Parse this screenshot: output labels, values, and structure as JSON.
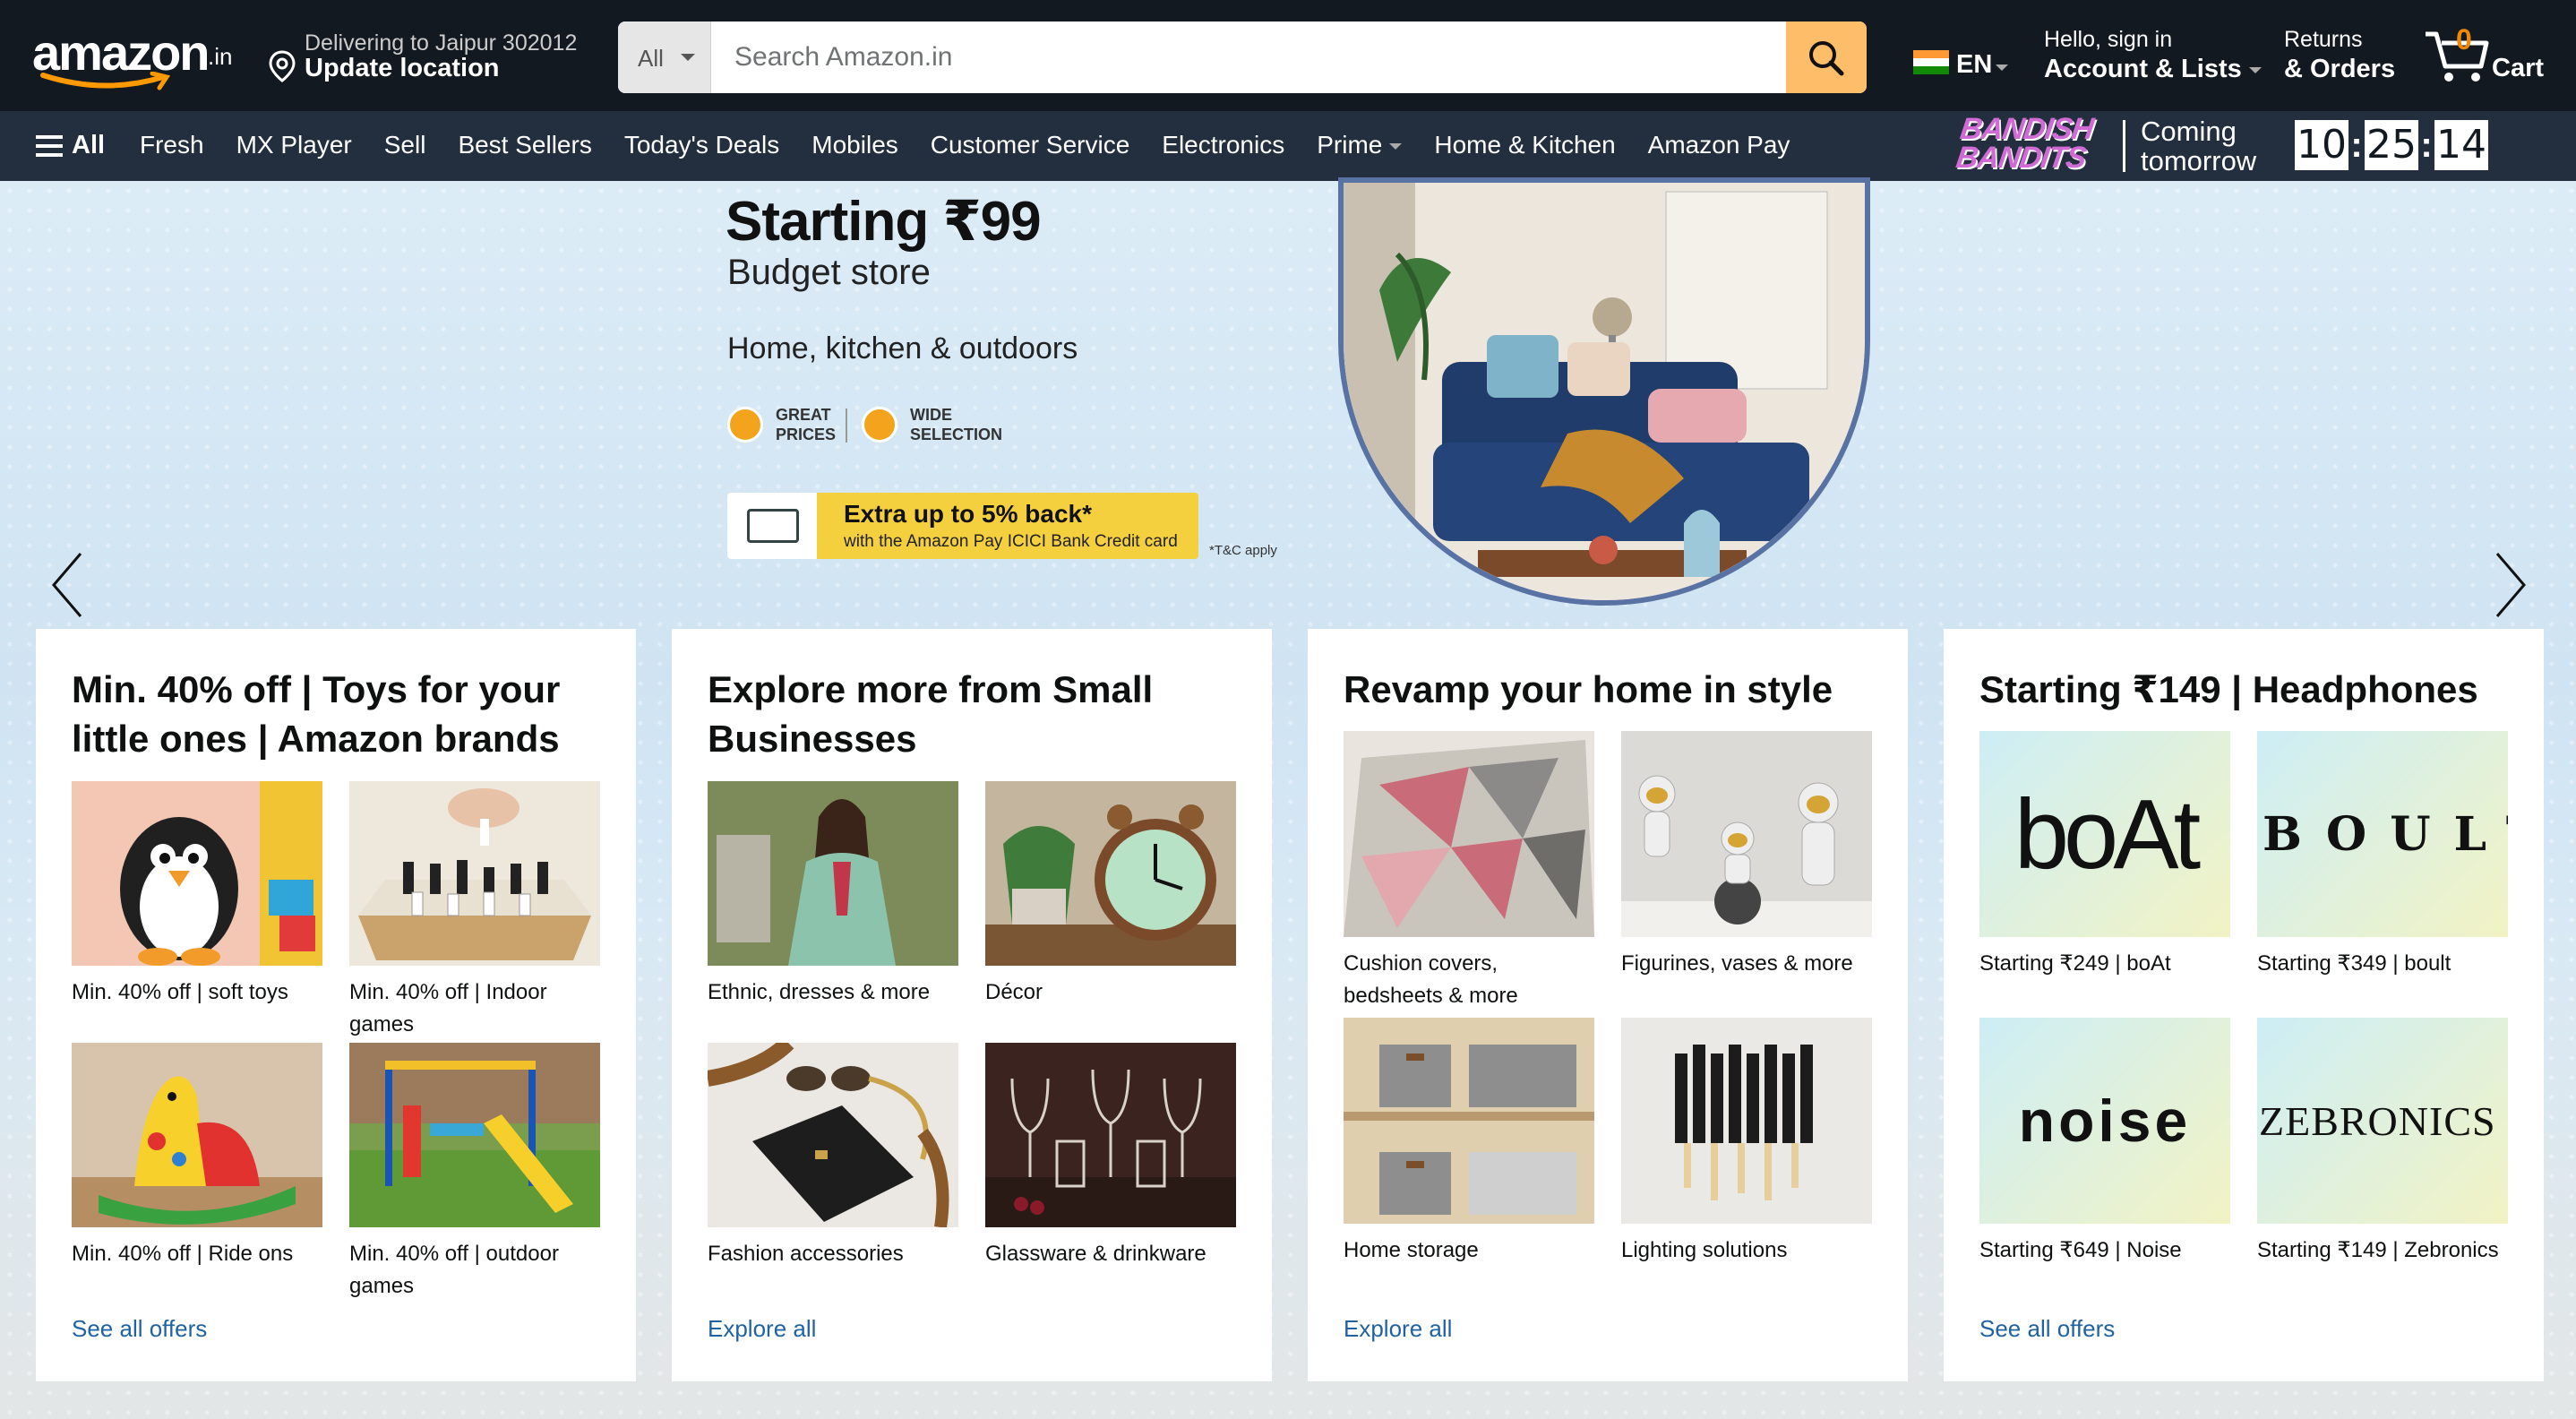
{
  "header": {
    "logo": "amazon",
    "logo_tld": ".in",
    "delivery_line1": "Delivering to Jaipur 302012",
    "delivery_line2": "Update location",
    "search_category": "All",
    "search_placeholder": "Search Amazon.in",
    "language": "EN",
    "account_line1": "Hello, sign in",
    "account_line2": "Account & Lists",
    "returns_line1": "Returns",
    "returns_line2": "& Orders",
    "cart_count": "0",
    "cart_label": "Cart"
  },
  "subnav": {
    "all_label": "All",
    "items": [
      "Fresh",
      "MX Player",
      "Sell",
      "Best Sellers",
      "Today's Deals",
      "Mobiles",
      "Customer Service",
      "Electronics",
      "Prime",
      "Home & Kitchen",
      "Amazon Pay"
    ],
    "promo_show_line1": "BANDISH",
    "promo_show_line2": "BANDITS",
    "promo_status_line1": "Coming",
    "promo_status_line2": "tomorrow",
    "timer": [
      "10",
      "25",
      "14"
    ]
  },
  "hero": {
    "headline": "Starting ₹99",
    "subheadline": "Budget store",
    "category_line": "Home, kitchen & outdoors",
    "badge1_line1": "GREAT",
    "badge1_line2": "PRICES",
    "badge2_line1": "WIDE",
    "badge2_line2": "SELECTION",
    "bank_offer_title": "Extra up to 5% back*",
    "bank_offer_sub": "with the Amazon Pay ICICI Bank Credit card",
    "tnc": "*T&C apply"
  },
  "cards": [
    {
      "title": "Min. 40% off | Toys for your little ones | Amazon brands",
      "tiles": [
        "Min. 40% off | soft toys",
        "Min. 40% off | Indoor games",
        "Min. 40% off | Ride ons",
        "Min. 40% off | outdoor games"
      ],
      "link": "See all offers"
    },
    {
      "title": "Explore more from Small Businesses",
      "tiles": [
        "Ethnic, dresses & more",
        "Décor",
        "Fashion accessories",
        "Glassware & drinkware"
      ],
      "link": "Explore all"
    },
    {
      "title": "Revamp your home in style",
      "tiles": [
        "Cushion covers, bedsheets & more",
        "Figurines, vases & more",
        "Home storage",
        "Lighting solutions"
      ],
      "link": "Explore all"
    },
    {
      "title": "Starting ₹149 | Headphones",
      "tiles": [
        "Starting ₹249 | boAt",
        "Starting ₹349 | boult",
        "Starting ₹649 | Noise",
        "Starting ₹149 | Zebronics"
      ],
      "brands": [
        "boAt",
        "BOULT",
        "noise",
        "ZEBRONICS"
      ],
      "link": "See all offers"
    }
  ],
  "colors": {
    "nav_bg": "#131921",
    "subnav_bg": "#232f3e",
    "search_button": "#febd69",
    "link": "#2162a1",
    "cart_count": "#f08804"
  }
}
